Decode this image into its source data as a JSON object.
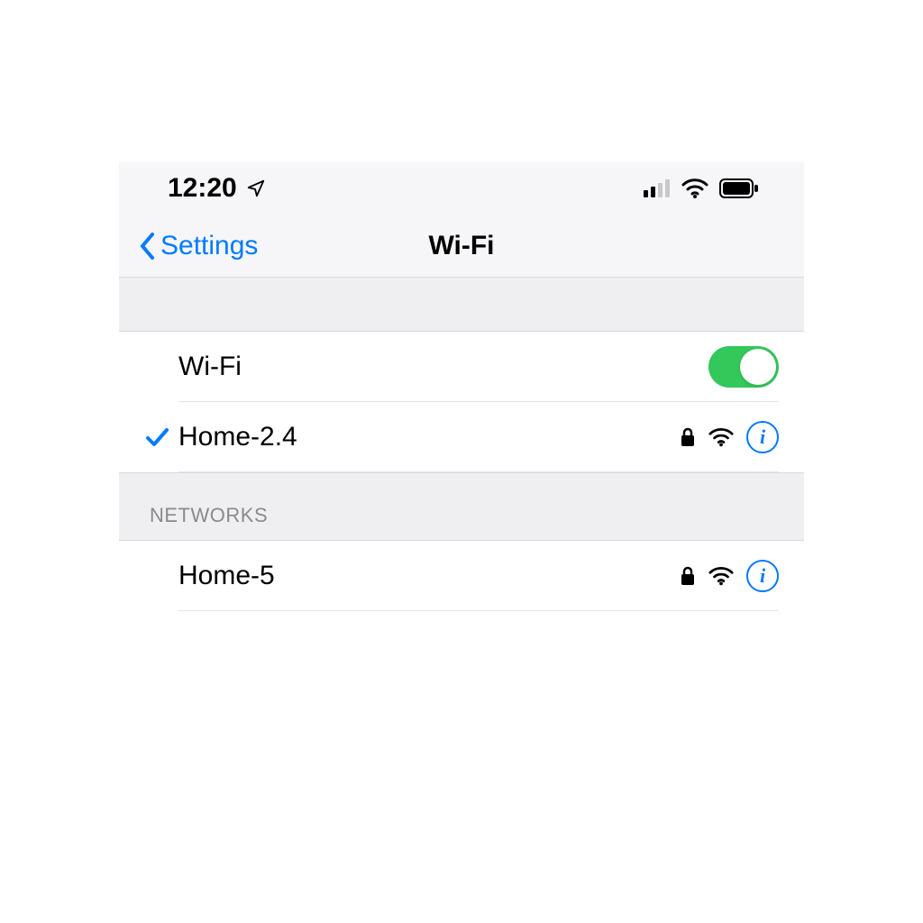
{
  "status_bar": {
    "time": "12:20",
    "location_icon": "location-arrow-icon",
    "cell_bars": 2,
    "wifi_icon": "wifi-icon",
    "battery_icon": "battery-full-icon"
  },
  "nav": {
    "back_label": "Settings",
    "title": "Wi-Fi"
  },
  "wifi_toggle": {
    "label": "Wi-Fi",
    "on": true
  },
  "connected_network": {
    "name": "Home-2.4",
    "checked": true,
    "secured": true,
    "signal": "wifi-icon",
    "info": "info-icon"
  },
  "sections": {
    "networks_header": "NETWORKS"
  },
  "networks": [
    {
      "name": "Home-5",
      "secured": true,
      "signal": "wifi-icon",
      "info": "info-icon"
    }
  ],
  "colors": {
    "accent": "#007aff",
    "toggle_on": "#34c759",
    "section_text": "#8a8a8e"
  }
}
